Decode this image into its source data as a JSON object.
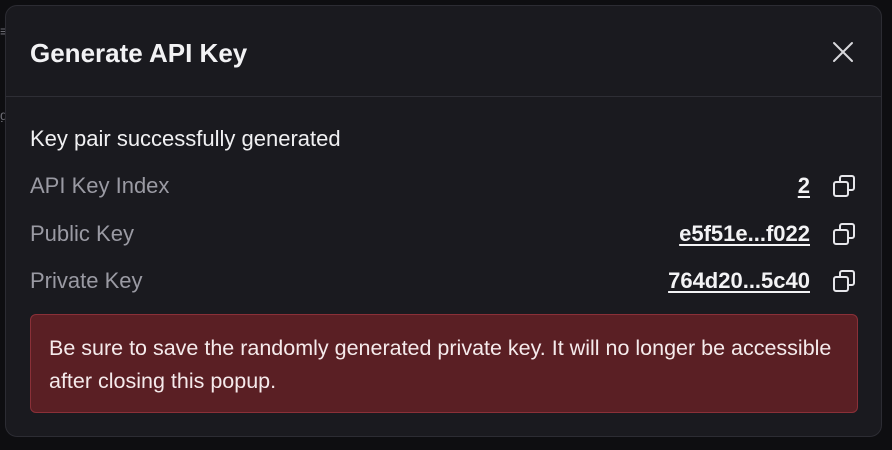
{
  "background": {
    "glyphs": [
      "≡",
      "g"
    ]
  },
  "modal": {
    "title": "Generate API Key",
    "close_icon": "close-icon",
    "success_message": "Key pair successfully generated",
    "rows": [
      {
        "label": "API Key Index",
        "value": "2",
        "copy_icon": "copy-icon"
      },
      {
        "label": "Public Key",
        "value": "e5f51e...f022",
        "copy_icon": "copy-icon"
      },
      {
        "label": "Private Key",
        "value": "764d20...5c40",
        "copy_icon": "copy-icon"
      }
    ],
    "warning": "Be sure to save the randomly generated private key. It will no longer be accessible after closing this popup."
  },
  "colors": {
    "modal_bg": "#1a1a1f",
    "warning_bg": "#5a1f24",
    "warning_border": "#8a3038",
    "label": "#9a9aa3",
    "text": "#f2f2f4"
  }
}
